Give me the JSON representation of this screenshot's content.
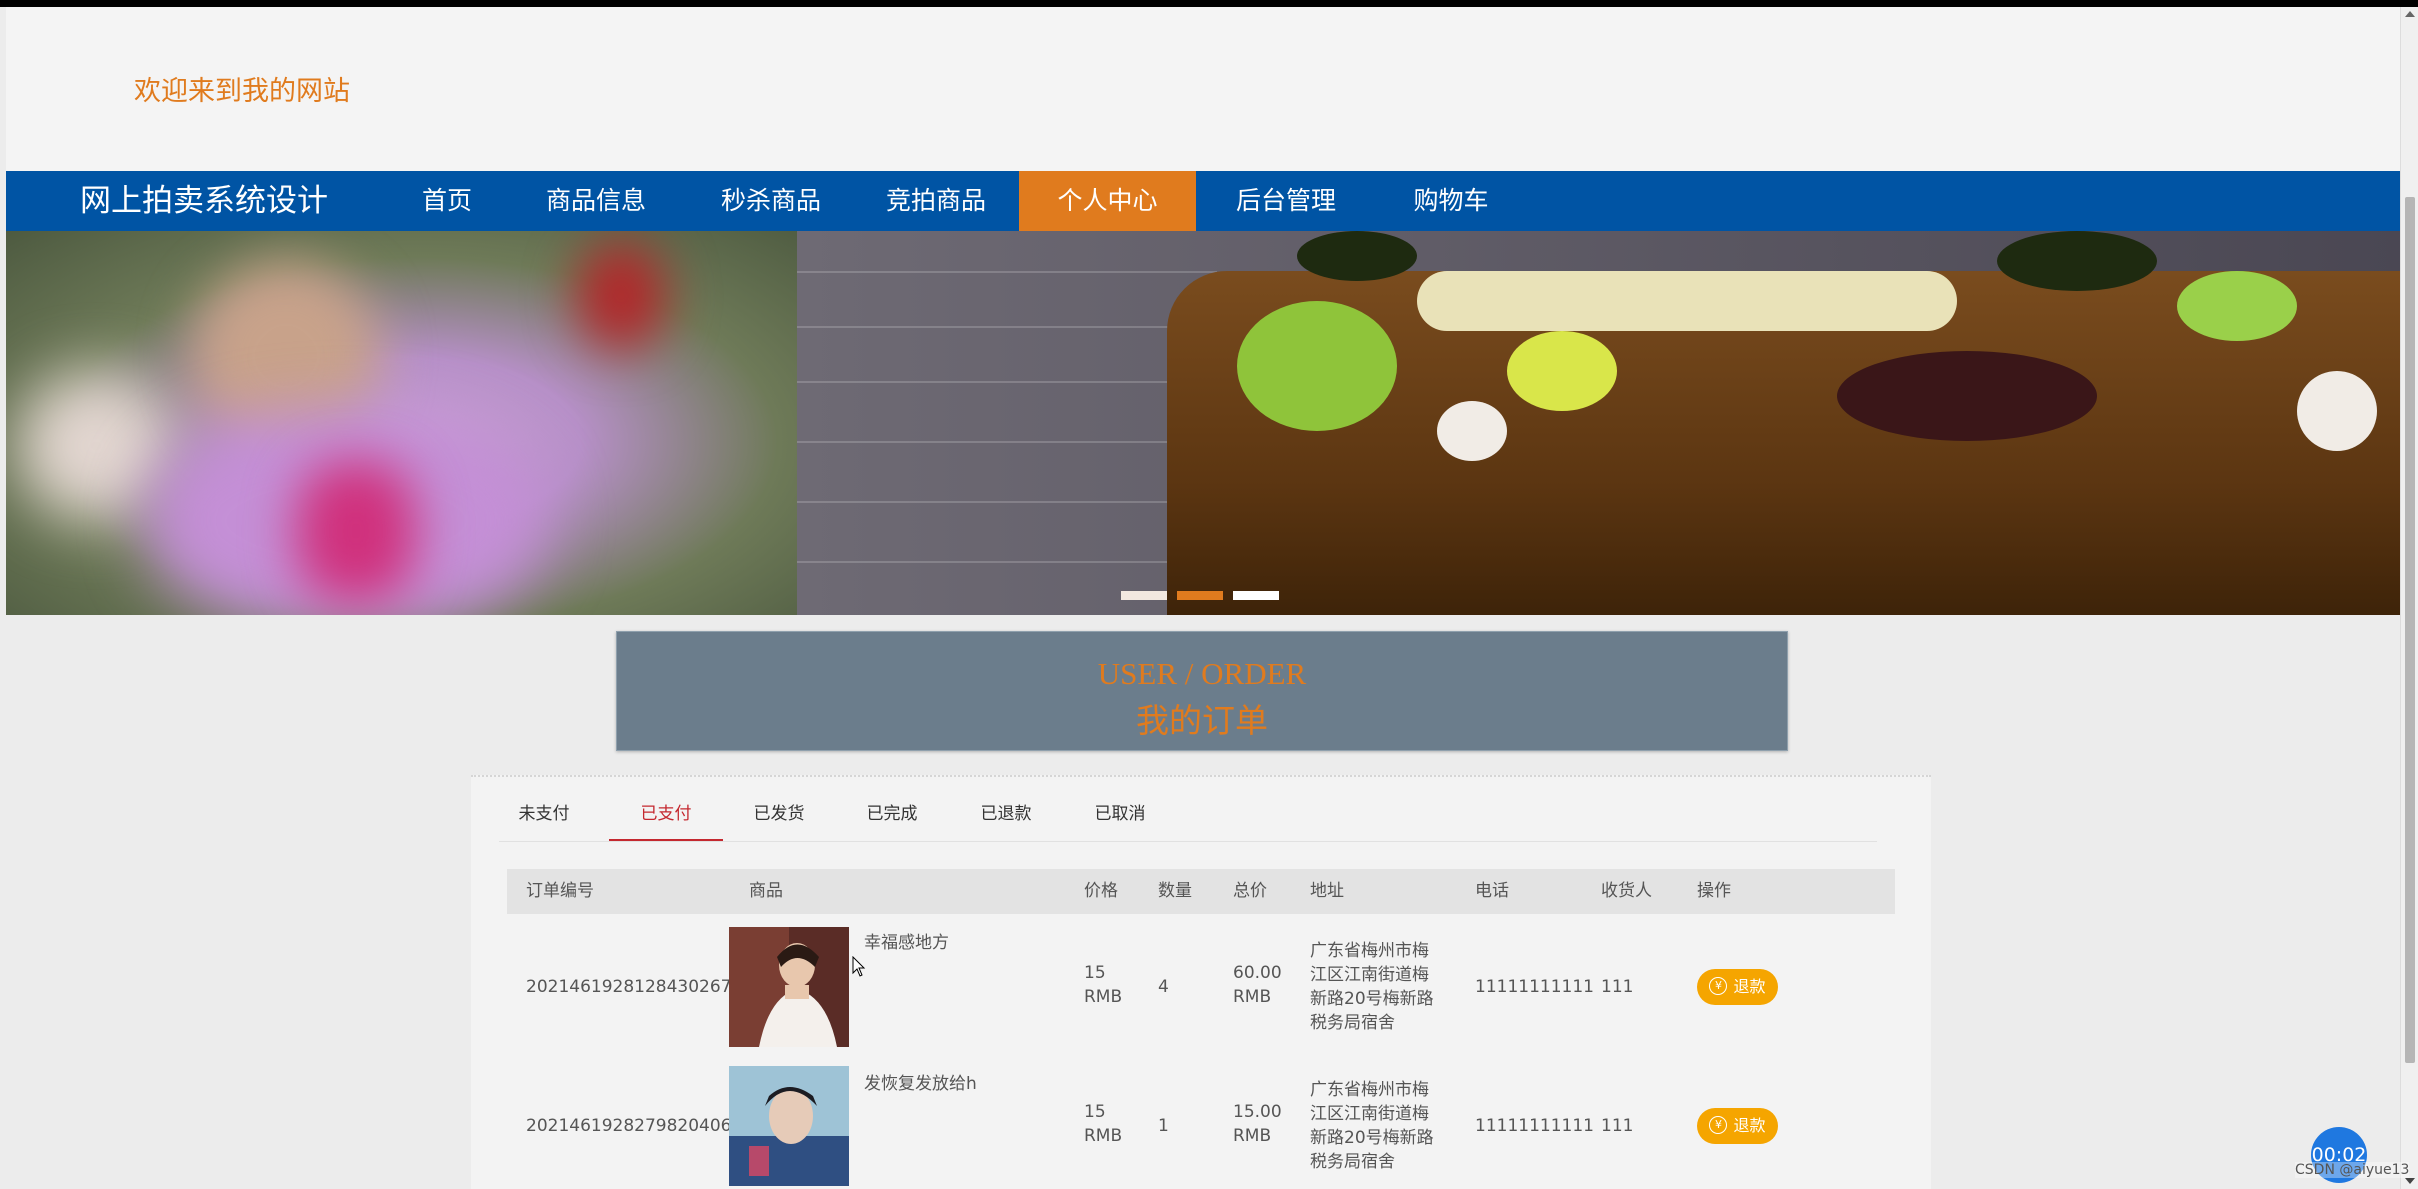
{
  "header": {
    "welcome": "欢迎来到我的网站"
  },
  "nav": {
    "site_title": "网上拍卖系统设计",
    "items": [
      {
        "label": "首页"
      },
      {
        "label": "商品信息"
      },
      {
        "label": "秒杀商品"
      },
      {
        "label": "竞拍商品"
      },
      {
        "label": "个人中心"
      },
      {
        "label": "后台管理"
      },
      {
        "label": "购物车"
      }
    ],
    "active": "个人中心"
  },
  "banner": {
    "slides": 3,
    "active_slide": 2
  },
  "order_header": {
    "en": "USER / ORDER",
    "cn": "我的订单"
  },
  "tabs": [
    {
      "label": "未支付"
    },
    {
      "label": "已支付"
    },
    {
      "label": "已发货"
    },
    {
      "label": "已完成"
    },
    {
      "label": "已退款"
    },
    {
      "label": "已取消"
    }
  ],
  "active_tab": "已支付",
  "table": {
    "headers": {
      "order_no": "订单编号",
      "product": "商品",
      "price": "价格",
      "qty": "数量",
      "total": "总价",
      "address": "地址",
      "phone": "电话",
      "receiver": "收货人",
      "action": "操作"
    },
    "rows": [
      {
        "order_no": "2021461928128430267",
        "product_name": "幸福感地方",
        "price_line1": "15",
        "price_line2": "RMB",
        "qty": "4",
        "total_line1": "60.00",
        "total_line2": "RMB",
        "address_lines": [
          "广东省梅州市梅",
          "江区江南街道梅",
          "新路20号梅新路",
          "税务局宿舍"
        ],
        "phone": "11111111111",
        "receiver": "111",
        "action": "退款"
      },
      {
        "order_no": "2021461928279820406",
        "product_name": "发恢复发放给h",
        "price_line1": "15",
        "price_line2": "RMB",
        "qty": "1",
        "total_line1": "15.00",
        "total_line2": "RMB",
        "address_lines": [
          "广东省梅州市梅",
          "江区江南街道梅",
          "新路20号梅新路",
          "税务局宿舍"
        ],
        "phone": "11111111111",
        "receiver": "111",
        "action": "退款"
      }
    ]
  },
  "overlay": {
    "timer": "00:02",
    "watermark": "CSDN @aiyue13"
  },
  "colors": {
    "nav_bg": "#0054a4",
    "accent": "#e07b1e",
    "order_header_bg": "#6b7d8c",
    "refund_btn": "#f5a500",
    "active_tab": "#c4282f"
  }
}
